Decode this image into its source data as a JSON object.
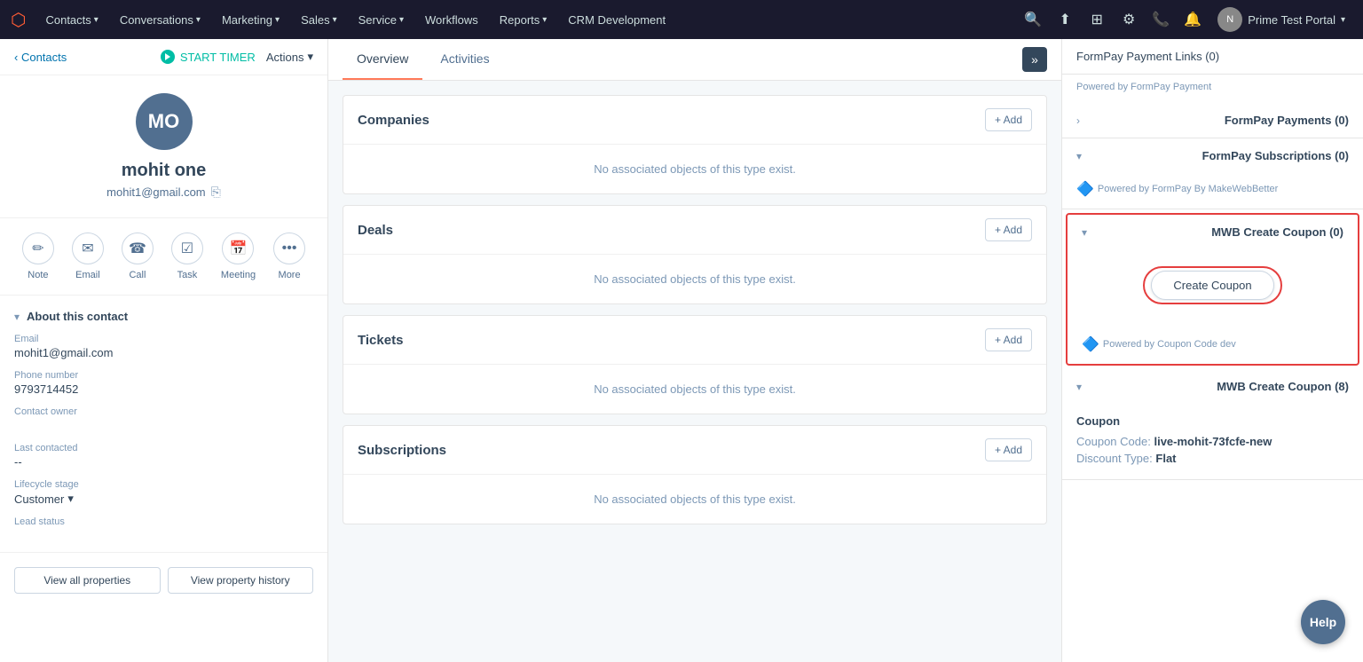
{
  "nav": {
    "logo": "⬡",
    "items": [
      {
        "label": "Contacts",
        "has_dropdown": true
      },
      {
        "label": "Conversations",
        "has_dropdown": true
      },
      {
        "label": "Marketing",
        "has_dropdown": true
      },
      {
        "label": "Sales",
        "has_dropdown": true
      },
      {
        "label": "Service",
        "has_dropdown": true
      },
      {
        "label": "Workflows",
        "has_dropdown": false
      },
      {
        "label": "Reports",
        "has_dropdown": true
      },
      {
        "label": "CRM Development",
        "has_dropdown": false
      }
    ],
    "portal": "Prime Test Portal"
  },
  "left": {
    "contacts_link": "Contacts",
    "start_timer": "START TIMER",
    "actions": "Actions",
    "avatar_initials": "MO",
    "contact_name": "mohit one",
    "contact_email": "mohit1@gmail.com",
    "action_icons": [
      {
        "name": "note-icon",
        "label": "Note",
        "symbol": "✏"
      },
      {
        "name": "email-icon",
        "label": "Email",
        "symbol": "✉"
      },
      {
        "name": "call-icon",
        "label": "Call",
        "symbol": "📞"
      },
      {
        "name": "task-icon",
        "label": "Task",
        "symbol": "☑"
      },
      {
        "name": "meeting-icon",
        "label": "Meeting",
        "symbol": "📅"
      },
      {
        "name": "more-icon",
        "label": "More",
        "symbol": "•••"
      }
    ],
    "about_section": {
      "title": "About this contact",
      "email_label": "Email",
      "email_value": "mohit1@gmail.com",
      "phone_label": "Phone number",
      "phone_value": "9793714452",
      "owner_label": "Contact owner",
      "owner_value": "",
      "last_contacted_label": "Last contacted",
      "last_contacted_value": "--",
      "lifecycle_label": "Lifecycle stage",
      "lifecycle_value": "Customer",
      "lead_status_label": "Lead status"
    },
    "view_props_btn": "View all properties",
    "view_history_btn": "View property history"
  },
  "center": {
    "tabs": [
      {
        "label": "Overview",
        "active": true
      },
      {
        "label": "Activities",
        "active": false
      }
    ],
    "sections": [
      {
        "title": "Companies",
        "empty_msg": "No associated objects of this type exist.",
        "add_label": "+ Add"
      },
      {
        "title": "Deals",
        "empty_msg": "No associated objects of this type exist.",
        "add_label": "+ Add"
      },
      {
        "title": "Tickets",
        "empty_msg": "No associated objects of this type exist.",
        "add_label": "+ Add"
      },
      {
        "title": "Subscriptions",
        "empty_msg": "No associated objects of this type exist.",
        "add_label": "+ Add"
      }
    ]
  },
  "right": {
    "top_item": "FormPay Payment Links (0)",
    "powered_by_1": "Powered by FormPay Payment",
    "sections": [
      {
        "title": "FormPay Payments (0)",
        "collapsed": true,
        "chevron": "›"
      },
      {
        "title": "FormPay Subscriptions (0)",
        "collapsed": false,
        "chevron": "›",
        "powered_by": "Powered by FormPay By MakeWebBetter"
      },
      {
        "title": "MWB Create Coupon (0)",
        "highlighted": true,
        "collapsed": false,
        "chevron": "›",
        "create_coupon_label": "Create Coupon",
        "powered_by": "Powered by Coupon Code dev"
      },
      {
        "title": "MWB Create Coupon (8)",
        "collapsed": false,
        "chevron": "›",
        "coupon_title": "Coupon",
        "coupon_code_label": "Coupon Code:",
        "coupon_code_value": "live-mohit-73fcfe-new",
        "discount_type_label": "Discount Type:",
        "discount_type_value": "Flat"
      }
    ]
  },
  "help_btn": "Help"
}
